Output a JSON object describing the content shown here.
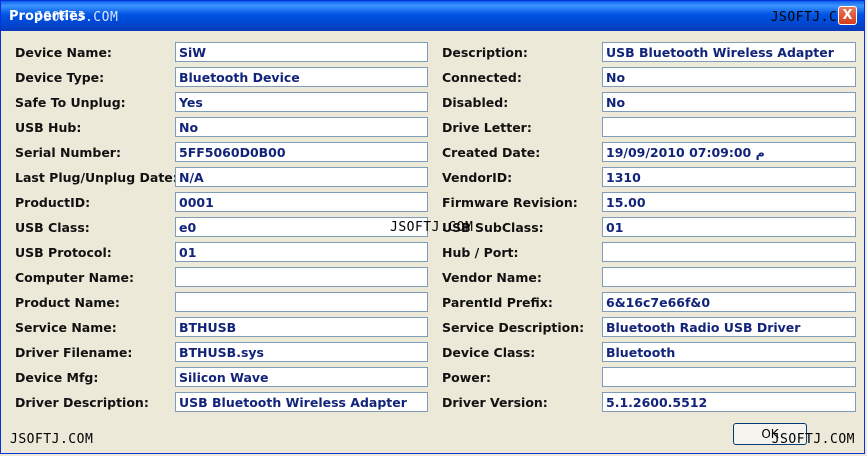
{
  "window": {
    "title": "Properties",
    "close_label": "X"
  },
  "watermark": {
    "text": "JSOFTJ.COM"
  },
  "left_column": [
    {
      "label": "Device Name:",
      "value": "SiW"
    },
    {
      "label": "Device Type:",
      "value": "Bluetooth Device"
    },
    {
      "label": "Safe To Unplug:",
      "value": "Yes"
    },
    {
      "label": "USB Hub:",
      "value": "No"
    },
    {
      "label": "Serial Number:",
      "value": "5FF5060D0B00"
    },
    {
      "label": "Last Plug/Unplug Date:",
      "value": "N/A"
    },
    {
      "label": "ProductID:",
      "value": "0001"
    },
    {
      "label": "USB Class:",
      "value": "e0"
    },
    {
      "label": "USB Protocol:",
      "value": "01"
    },
    {
      "label": "Computer Name:",
      "value": ""
    },
    {
      "label": "Product Name:",
      "value": ""
    },
    {
      "label": "Service Name:",
      "value": "BTHUSB"
    },
    {
      "label": "Driver Filename:",
      "value": "BTHUSB.sys"
    },
    {
      "label": "Device Mfg:",
      "value": "Silicon Wave"
    },
    {
      "label": "Driver Description:",
      "value": "USB Bluetooth Wireless Adapter"
    }
  ],
  "right_column": [
    {
      "label": "Description:",
      "value": "USB Bluetooth Wireless Adapter"
    },
    {
      "label": "Connected:",
      "value": "No"
    },
    {
      "label": "Disabled:",
      "value": "No"
    },
    {
      "label": "Drive Letter:",
      "value": ""
    },
    {
      "label": "Created Date:",
      "value": "19/09/2010 07:09:00 م"
    },
    {
      "label": "VendorID:",
      "value": "1310"
    },
    {
      "label": "Firmware Revision:",
      "value": "15.00"
    },
    {
      "label": "USB SubClass:",
      "value": "01"
    },
    {
      "label": "Hub / Port:",
      "value": ""
    },
    {
      "label": "Vendor Name:",
      "value": ""
    },
    {
      "label": "ParentId Prefix:",
      "value": "6&16c7e66f&0"
    },
    {
      "label": "Service Description:",
      "value": "Bluetooth Radio USB Driver"
    },
    {
      "label": "Device Class:",
      "value": "Bluetooth"
    },
    {
      "label": "Power:",
      "value": ""
    },
    {
      "label": "Driver Version:",
      "value": "5.1.2600.5512"
    }
  ],
  "buttons": {
    "ok_label": "OK"
  }
}
